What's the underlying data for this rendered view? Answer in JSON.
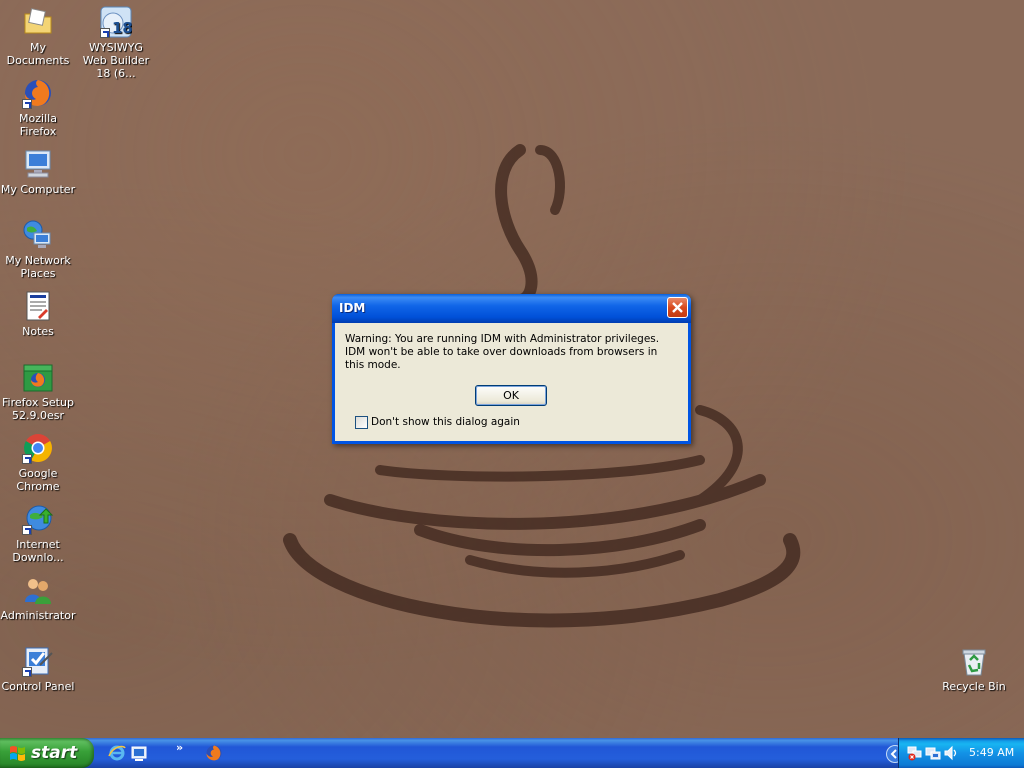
{
  "desktop": {
    "icons": [
      {
        "label": "My Documents"
      },
      {
        "label": "WYSIWYG Web Builder 18 (6..."
      },
      {
        "label": "Mozilla Firefox"
      },
      {
        "label": "My Computer"
      },
      {
        "label": "My Network Places"
      },
      {
        "label": "Notes"
      },
      {
        "label": "Firefox Setup 52.9.0esr"
      },
      {
        "label": "Google Chrome"
      },
      {
        "label": "Internet Downlo..."
      },
      {
        "label": "Administrator"
      },
      {
        "label": "Control Panel"
      },
      {
        "label": "Recycle Bin"
      }
    ]
  },
  "dialog": {
    "title": "IDM",
    "message_line1": "Warning: You are running IDM with Administrator privileges.",
    "message_line2": "IDM won't be able to take over downloads from browsers in this mode.",
    "ok_label": "OK",
    "checkbox_label": "Don't show this dialog again",
    "checkbox_checked": false
  },
  "taskbar": {
    "start_label": "start",
    "quick_launch_chevron": "»",
    "clock": "5:49 AM"
  },
  "colors": {
    "title_bar": "#0054e3",
    "start_button": "#3c9a3c",
    "taskbar": "#245edb",
    "dialog_body": "#ece9d8"
  }
}
